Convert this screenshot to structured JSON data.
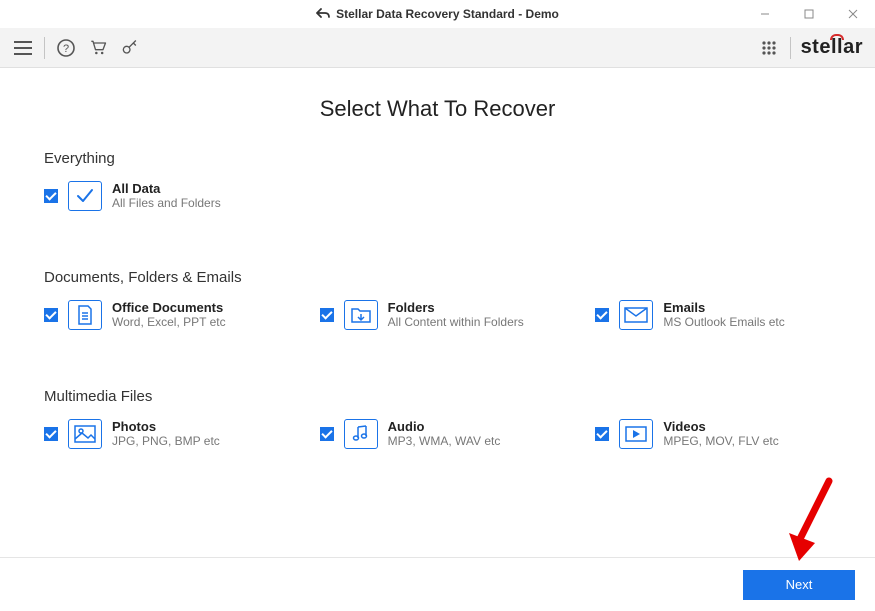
{
  "window": {
    "title": "Stellar Data Recovery Standard - Demo"
  },
  "brand": "stellar",
  "page": {
    "title": "Select What To Recover"
  },
  "sections": {
    "everything": {
      "label": "Everything",
      "all_data": {
        "title": "All Data",
        "sub": "All Files and Folders"
      }
    },
    "docs": {
      "label": "Documents, Folders & Emails",
      "office": {
        "title": "Office Documents",
        "sub": "Word, Excel, PPT etc"
      },
      "folders": {
        "title": "Folders",
        "sub": "All Content within Folders"
      },
      "emails": {
        "title": "Emails",
        "sub": "MS Outlook Emails etc"
      }
    },
    "media": {
      "label": "Multimedia Files",
      "photos": {
        "title": "Photos",
        "sub": "JPG, PNG, BMP etc"
      },
      "audio": {
        "title": "Audio",
        "sub": "MP3, WMA, WAV etc"
      },
      "videos": {
        "title": "Videos",
        "sub": "MPEG, MOV, FLV etc"
      }
    }
  },
  "footer": {
    "next": "Next"
  }
}
